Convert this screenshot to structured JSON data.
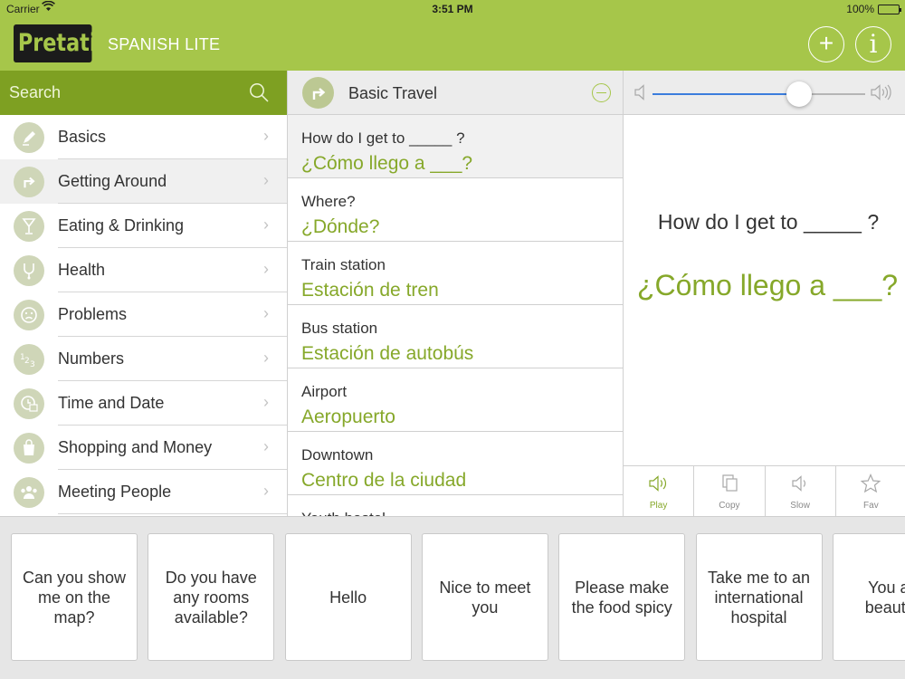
{
  "status_bar": {
    "carrier": "Carrier",
    "time": "3:51 PM",
    "battery": "100%"
  },
  "app": {
    "logo": "Pretati",
    "subtitle": "SPANISH LITE",
    "add_label": "+",
    "info_label": "i"
  },
  "colors": {
    "accent": "#a6c64a",
    "accent_dark": "#7ea022",
    "spanish_text": "#86a82a",
    "logo_bg": "#1b1b1b"
  },
  "search": {
    "placeholder": "Search"
  },
  "categories": [
    {
      "label": "Basics",
      "icon": "pen-icon"
    },
    {
      "label": "Getting Around",
      "icon": "turn-arrow-icon",
      "selected": true
    },
    {
      "label": "Eating & Drinking",
      "icon": "glass-icon"
    },
    {
      "label": "Health",
      "icon": "stethoscope-icon"
    },
    {
      "label": "Problems",
      "icon": "sad-face-icon"
    },
    {
      "label": "Numbers",
      "icon": "numbers-icon"
    },
    {
      "label": "Time and Date",
      "icon": "clock-calendar-icon"
    },
    {
      "label": "Shopping and Money",
      "icon": "shopping-bag-icon"
    },
    {
      "label": "Meeting People",
      "icon": "people-icon"
    }
  ],
  "phrase_list": {
    "title": "Basic Travel",
    "items": [
      {
        "en": "How do I get to _____ ?",
        "es": "¿Cómo llego a ___?",
        "selected": true
      },
      {
        "en": "Where?",
        "es": "¿Dónde?"
      },
      {
        "en": "Train station",
        "es": "Estación de tren"
      },
      {
        "en": "Bus station",
        "es": "Estación de autobús"
      },
      {
        "en": "Airport",
        "es": "Aeropuerto"
      },
      {
        "en": "Downtown",
        "es": "Centro de la ciudad"
      },
      {
        "en": "Youth hostel",
        "es": ""
      }
    ]
  },
  "detail": {
    "en": "How do I get to _____ ?",
    "es": "¿Cómo llego a ___?",
    "volume_percent": 69,
    "actions": [
      {
        "label": "Play",
        "icon": "speaker-icon",
        "active": true
      },
      {
        "label": "Copy",
        "icon": "copy-icon"
      },
      {
        "label": "Slow",
        "icon": "speaker-slow-icon"
      },
      {
        "label": "Fav",
        "icon": "star-icon"
      }
    ]
  },
  "quick_phrases": [
    "Can you show me on the map?",
    "Do you have any rooms available?",
    "Hello",
    "Nice to meet you",
    "Please make the food spicy",
    "Take me to an international hospital",
    "You are beautiful"
  ]
}
